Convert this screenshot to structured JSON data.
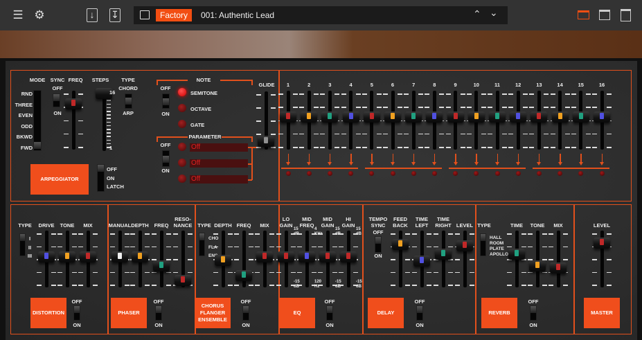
{
  "toolbar": {
    "icons": [
      "menu-icon",
      "gear-icon",
      "import-icon",
      "export-icon",
      "folder-icon",
      "arrow-up-icon",
      "arrow-down-icon",
      "view-small-icon",
      "view-medium-icon",
      "view-large-icon"
    ],
    "preset_bank": "Factory",
    "preset_name": "001: Authentic Lead",
    "accent": "#f24e12"
  },
  "arpeggiator": {
    "title": "ARPEGGIATOR",
    "mode_label": "MODE",
    "mode_options": [
      "RND",
      "THREE",
      "EVEN",
      "ODD",
      "BKWD",
      "FWD"
    ],
    "mode_selected": "FWD",
    "sync_label": "SYNC",
    "sync_off": "OFF",
    "sync_on": "ON",
    "sync_state": "OFF",
    "freq_label": "FREQ",
    "freq_value": 0.8,
    "steps_label": "STEPS",
    "steps_max": "16",
    "steps_min": "1",
    "steps_value": 1.0,
    "type_label": "TYPE",
    "type_chord": "CHORD",
    "type_arp": "ARP",
    "type_state": "CHORD",
    "latch_options": [
      "OFF",
      "ON",
      "LATCH"
    ],
    "latch_state": "OFF"
  },
  "note": {
    "title": "NOTE",
    "off": "OFF",
    "on": "ON",
    "options": [
      "SEMITONE",
      "OCTAVE",
      "GATE"
    ],
    "active": "SEMITONE"
  },
  "parameter": {
    "title": "PARAMETER",
    "off": "OFF",
    "on": "ON",
    "displays": [
      "Off",
      "Off",
      "Off"
    ]
  },
  "glide": {
    "label": "GLIDE",
    "value": 0.1
  },
  "sequencer": {
    "labels": [
      "1",
      "2",
      "3",
      "4",
      "5",
      "6",
      "7",
      "8",
      "9",
      "10",
      "11",
      "12",
      "13",
      "14",
      "15",
      "16"
    ],
    "values": [
      0.56,
      0.56,
      0.56,
      0.56,
      0.56,
      0.56,
      0.56,
      0.56,
      0.56,
      0.56,
      0.56,
      0.56,
      0.56,
      0.56,
      0.56,
      0.56
    ]
  },
  "colors": {
    "red": "#c02828",
    "orange": "#f0a020",
    "green": "#20a080",
    "blue": "#5050e0",
    "white": "#f0f0f0",
    "grey": "#909090",
    "accent": "#f04e1c"
  },
  "distortion": {
    "title": "DISTORTION",
    "type_label": "TYPE",
    "types": [
      "I",
      "II",
      "III"
    ],
    "type_state": "I",
    "sliders": [
      {
        "label": "DRIVE",
        "value": 0.54,
        "color": "blue"
      },
      {
        "label": "TONE",
        "value": 0.54,
        "color": "orange"
      },
      {
        "label": "MIX",
        "value": 0.54,
        "color": "red"
      }
    ],
    "off": "OFF",
    "on": "ON",
    "state": "OFF"
  },
  "phaser": {
    "title": "PHASER",
    "sliders": [
      {
        "label": "MANUAL",
        "value": 0.54,
        "color": "white"
      },
      {
        "label": "DEPTH",
        "value": 0.54,
        "color": "orange"
      },
      {
        "label": "FREQ",
        "value": 0.37,
        "color": "green"
      },
      {
        "label": "RESO-\nNANCE",
        "value": 0.08,
        "color": "red"
      }
    ],
    "off": "OFF",
    "on": "ON",
    "state": "OFF"
  },
  "chorus": {
    "title": "CHORUS\nFLANGER\nENSEMBLE",
    "type_label": "TYPE",
    "types": [
      "CHO",
      "FLA",
      "ENS"
    ],
    "type_state": "CHO",
    "sliders": [
      {
        "label": "DEPTH",
        "value": 0.47,
        "color": "orange"
      },
      {
        "label": "FREQ",
        "value": 0.17,
        "color": "green"
      },
      {
        "label": "MIX",
        "value": 0.54,
        "color": "red"
      }
    ],
    "off": "OFF",
    "on": "ON",
    "state": "OFF"
  },
  "eq": {
    "title": "EQ",
    "sliders": [
      {
        "label": "LO\nGAIN",
        "value": 0.54,
        "color": "red",
        "max": "15\ndB",
        "min": "-15\ndB"
      },
      {
        "label": "MID\nFREQ",
        "value": 0.54,
        "color": "blue",
        "max": "4\nKHz",
        "min": "120\nHz"
      },
      {
        "label": "MID\nGAIN",
        "value": 0.54,
        "color": "red",
        "max": "15\ndB",
        "min": "-15\ndB"
      },
      {
        "label": "HI\nGAIN",
        "value": 0.54,
        "color": "red",
        "max": "15\ndB",
        "min": "-15\ndB"
      }
    ],
    "off": "OFF",
    "on": "ON",
    "state": "OFF"
  },
  "delay": {
    "title": "DELAY",
    "sync_label": "TEMPO\nSYNC",
    "sync_off": "OFF",
    "sync_on": "ON",
    "sync_state": "OFF",
    "sliders": [
      {
        "label": "FEED\nBACK",
        "value": 0.78,
        "color": "orange"
      },
      {
        "label": "TIME\nLEFT",
        "value": 0.46,
        "color": "blue"
      },
      {
        "label": "TIME\nRIGHT",
        "value": 0.6,
        "color": "green"
      },
      {
        "label": "LEVEL",
        "value": 0.76,
        "color": "red"
      }
    ],
    "off": "OFF",
    "on": "ON",
    "state": "OFF"
  },
  "reverb": {
    "title": "REVERB",
    "type_label": "TYPE",
    "types": [
      "HALL",
      "ROOM",
      "PLATE",
      "APOLLO"
    ],
    "type_state": "HALL",
    "sliders": [
      {
        "label": "TIME",
        "value": 0.59,
        "color": "green"
      },
      {
        "label": "TONE",
        "value": 0.37,
        "color": "orange"
      },
      {
        "label": "MIX",
        "value": 0.32,
        "color": "red"
      }
    ],
    "off": "OFF",
    "on": "ON",
    "state": "OFF"
  },
  "master": {
    "title": "MASTER",
    "sliders": [
      {
        "label": "LEVEL",
        "value": 0.81,
        "color": "red"
      }
    ]
  }
}
